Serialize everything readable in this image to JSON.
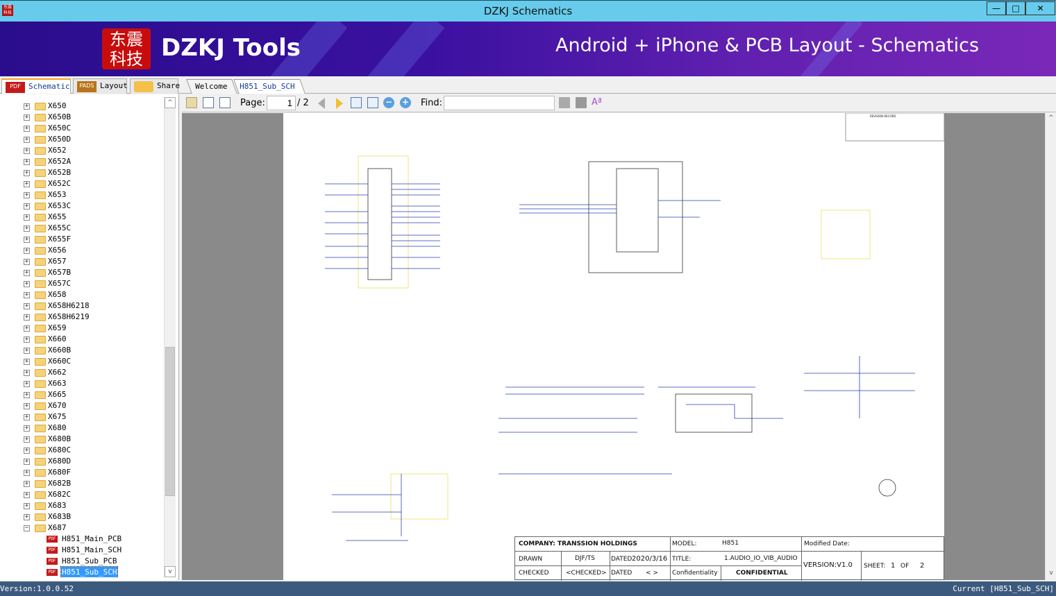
{
  "window": {
    "title": "DZKJ Schematics",
    "controls": [
      "—",
      "□",
      "✕"
    ]
  },
  "banner": {
    "logo_text": "东震科技",
    "brand": "DZKJ Tools",
    "slogan": "Android + iPhone & PCB Layout - Schematics"
  },
  "left_tabs": [
    {
      "label": "Schematic",
      "icon": "PDF"
    },
    {
      "label": "Layout",
      "icon": "PADS"
    },
    {
      "label": "Share",
      "icon": "cloud-plus"
    }
  ],
  "doc_tabs": [
    {
      "label": "Welcome"
    },
    {
      "label": "H851_Sub_SCH",
      "closable": true
    }
  ],
  "tree": {
    "folders": [
      "X650",
      "X650B",
      "X650C",
      "X650D",
      "X652",
      "X652A",
      "X652B",
      "X652C",
      "X653",
      "X653C",
      "X655",
      "X655C",
      "X655F",
      "X656",
      "X657",
      "X657B",
      "X657C",
      "X658",
      "X658H6218",
      "X658H6219",
      "X659",
      "X660",
      "X660B",
      "X660C",
      "X662",
      "X663",
      "X665",
      "X670",
      "X675",
      "X680",
      "X680B",
      "X680C",
      "X680D",
      "X680F",
      "X682B",
      "X682C",
      "X683",
      "X683B",
      "X687"
    ],
    "expanded": "X687",
    "files": [
      "H851_Main_PCB",
      "H851_Main_SCH",
      "H851_Sub_PCB",
      "H851_Sub_SCH"
    ],
    "selected": "H851_Sub_SCH"
  },
  "toolbar": {
    "page_label": "Page:",
    "page_value": "1",
    "page_total": "/ 2",
    "find_label": "Find:",
    "find_value": ""
  },
  "titleblock": {
    "company": "COMPANY: TRANSSION HOLDINGS",
    "model_label": "MODEL:",
    "model": "H851",
    "modified_label": "Modified Date:",
    "drawn": "DRAWN",
    "drawn_by": "DJF/TS",
    "dated": "DATED",
    "date": "2020/3/16",
    "title_label": "TITLE:",
    "title": "1.AUDIO_IO_VIB_AUDIO",
    "version": "VERSION:V1.0",
    "sheet_label": "SHEET:",
    "sheet": "1",
    "of": "OF",
    "sheet_total": "2",
    "checked": "CHECKED",
    "checked_by": "<CHECKED>",
    "dated2": "DATED",
    "date2": "< >",
    "conf_label": "Confidentiality",
    "conf": "CONFIDENTIAL",
    "revision": "REVISION RECORD"
  },
  "status": {
    "version": "Version:1.0.0.52",
    "current": "Current [H851_Sub_SCH]"
  },
  "colors": {
    "titlebar": "#67cbec",
    "banner": "#2a0d8c",
    "status": "#3c5a7d",
    "selection": "#3399ff"
  }
}
